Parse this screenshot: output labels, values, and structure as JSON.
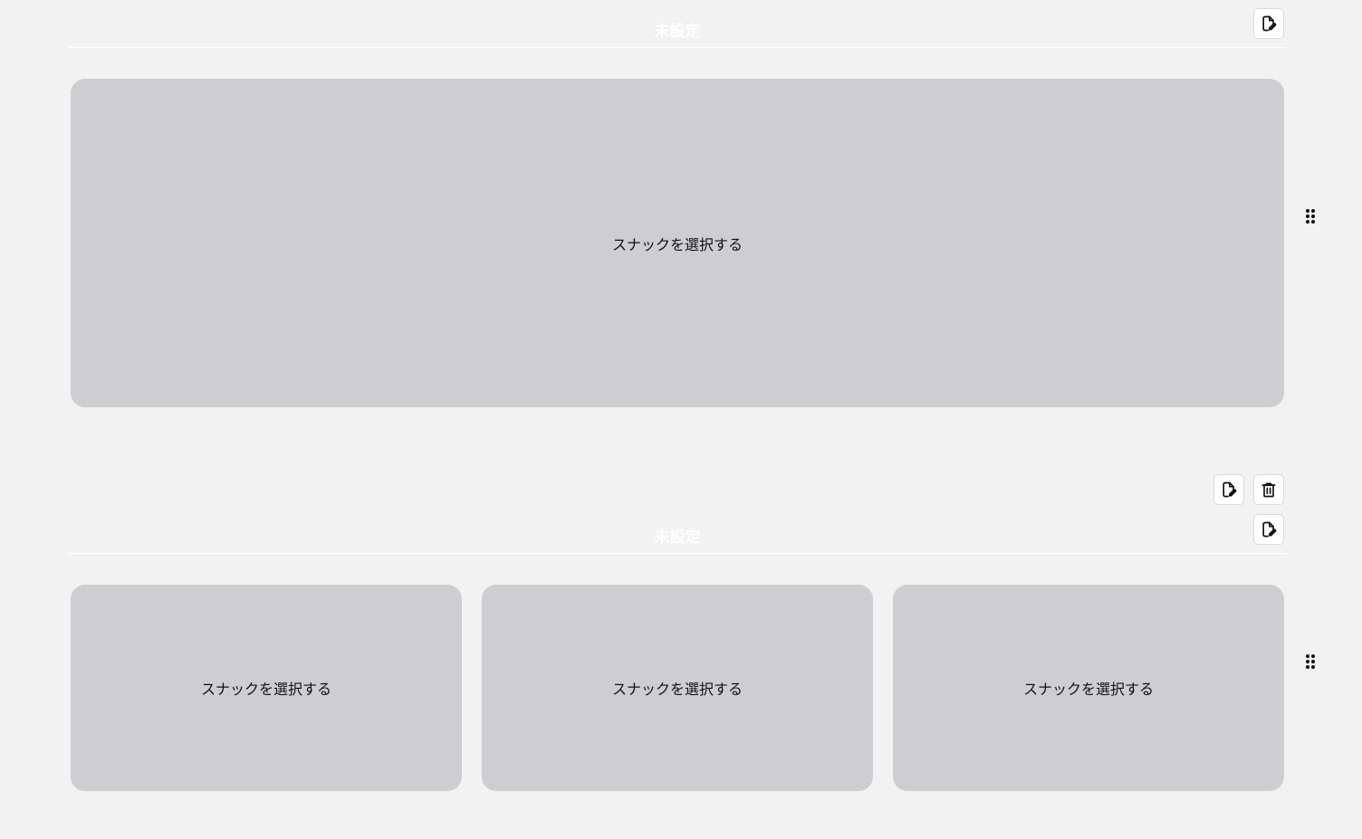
{
  "sections": [
    {
      "title": "未設定",
      "slots": [
        {
          "label": "スナックを選択する"
        }
      ]
    },
    {
      "title": "未設定",
      "slots": [
        {
          "label": "スナックを選択する"
        },
        {
          "label": "スナックを選択する"
        },
        {
          "label": "スナックを選択する"
        }
      ]
    }
  ],
  "icons": {
    "edit": "file-edit-icon",
    "delete": "trash-icon",
    "drag": "drag-handle-icon"
  },
  "colors": {
    "background": "#f2f2f2",
    "slot": "#cecdd1",
    "title": "#ffffff"
  }
}
